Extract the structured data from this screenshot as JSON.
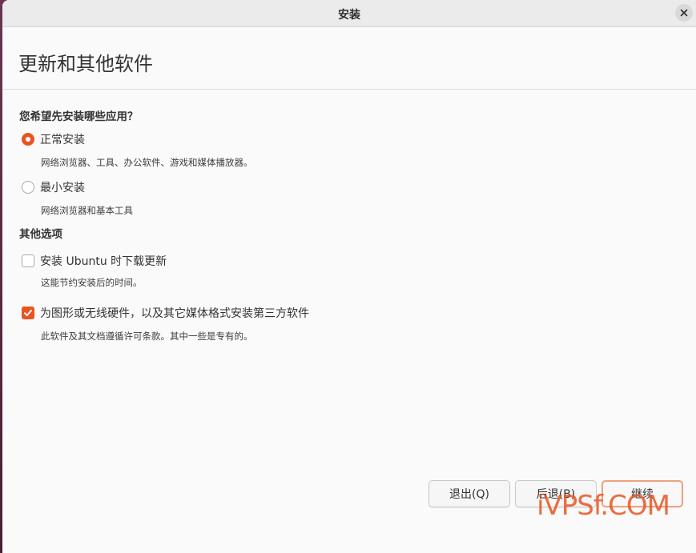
{
  "window": {
    "title": "安装"
  },
  "page": {
    "title": "更新和其他软件"
  },
  "install_type": {
    "heading": "您希望先安装哪些应用？",
    "options": [
      {
        "label": "正常安装",
        "description": "网络浏览器、工具、办公软件、游戏和媒体播放器。",
        "selected": true
      },
      {
        "label": "最小安装",
        "description": "网络浏览器和基本工具",
        "selected": false
      }
    ]
  },
  "other_options": {
    "heading": "其他选项",
    "items": [
      {
        "label": "安装 Ubuntu 时下载更新",
        "description": "这能节约安装后的时间。",
        "checked": false
      },
      {
        "label": "为图形或无线硬件，以及其它媒体格式安装第三方软件",
        "description": "此软件及其文档遵循许可条款。其中一些是专有的。",
        "checked": true
      }
    ]
  },
  "buttons": {
    "quit": "退出(Q)",
    "back": "后退(B)",
    "continue": "继续"
  },
  "watermark": "iVPSf.COM",
  "colors": {
    "accent": "#e95420",
    "background": "#fafafa",
    "titlebar": "#ebebeb"
  },
  "icons": {
    "close": "close-icon",
    "check": "check-icon"
  }
}
